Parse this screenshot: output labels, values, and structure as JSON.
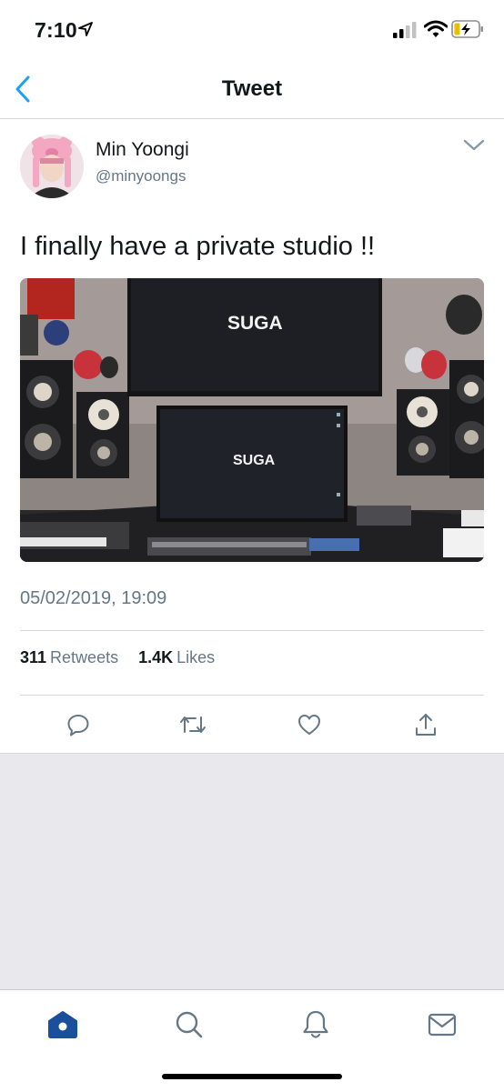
{
  "status_bar": {
    "time": "7:10"
  },
  "nav": {
    "title": "Tweet"
  },
  "tweet": {
    "author_name": "Min Yoongi",
    "author_handle": "@minyoongs",
    "text": "I finally have a private studio !!",
    "media_screen_text": "SUGA",
    "timestamp": "05/02/2019, 19:09",
    "retweets_count": "311",
    "retweets_label": "Retweets",
    "likes_count": "1.4K",
    "likes_label": "Likes"
  },
  "colors": {
    "accent": "#1da1f2",
    "home_active": "#1a4f9c",
    "text_secondary": "#657786",
    "background": "#e8e8ed"
  },
  "icons": {
    "status": [
      "location-arrow-icon",
      "cellular-signal-icon",
      "wifi-icon",
      "battery-charging-icon"
    ],
    "actions": [
      "reply-icon",
      "retweet-icon",
      "like-icon",
      "share-icon"
    ],
    "tabs": [
      "home-icon",
      "search-icon",
      "notifications-icon",
      "messages-icon"
    ]
  }
}
